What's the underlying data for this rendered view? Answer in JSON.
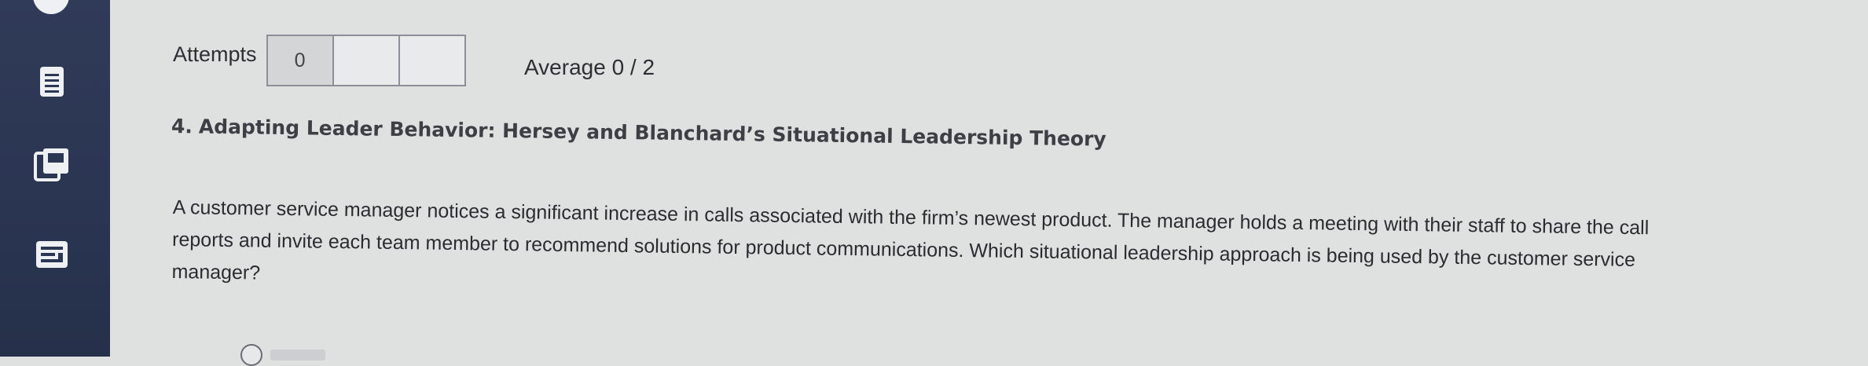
{
  "sidebar": {
    "items": [
      {
        "icon": "list-icon"
      },
      {
        "icon": "book-icon"
      },
      {
        "icon": "card-icon"
      }
    ]
  },
  "attempts": {
    "label": "Attempts",
    "boxes": [
      "0",
      "",
      ""
    ]
  },
  "average": {
    "label": "Average",
    "value": "0 / 2"
  },
  "question": {
    "number": "4.",
    "title": "Adapting Leader Behavior: Hersey and Blanchard’s Situational Leadership Theory",
    "body": "A customer service manager notices a significant increase in calls associated with the firm’s newest product. The manager holds a meeting with their staff to share the call reports and invite each team member to recommend solutions for product communications. Which situational leadership approach is being used by the customer service manager?"
  },
  "colors": {
    "sidebar": "#2c3754",
    "sidebar_icon": "#eef0f4",
    "page_background": "#dfe0e0",
    "text": "#2f2f33"
  }
}
